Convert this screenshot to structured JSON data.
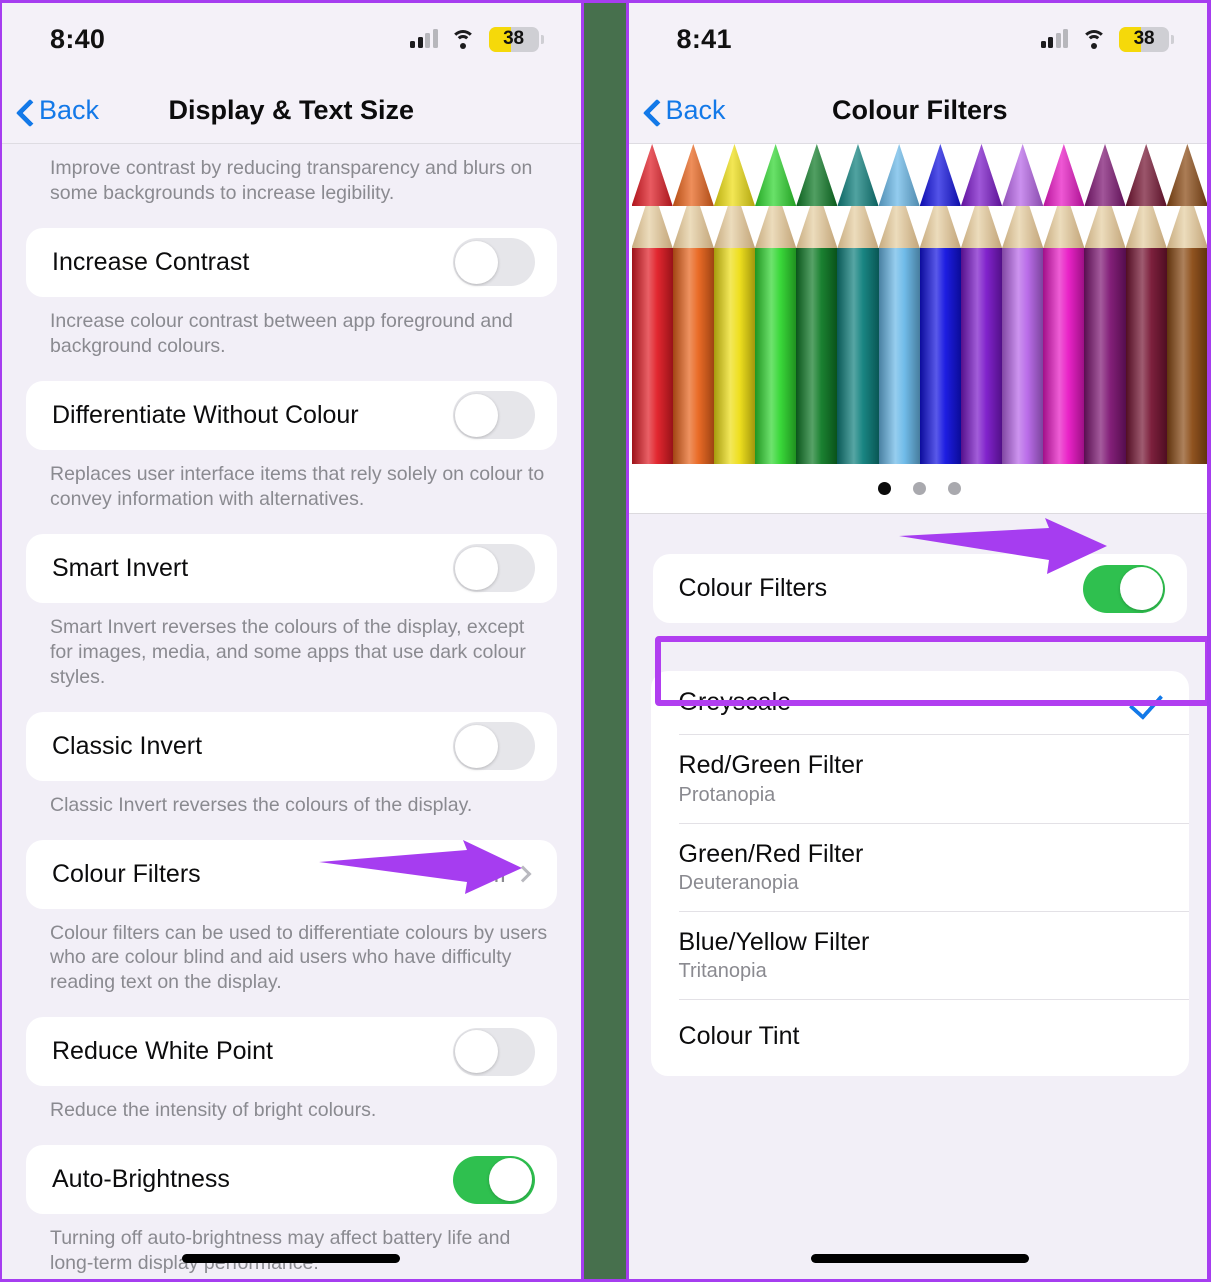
{
  "annotations": {
    "highlight_colour": "#b13ef0",
    "arrow_colour": "#a63df0"
  },
  "left_panel": {
    "status": {
      "time": "8:40",
      "signal_icon": "cellular-bars-icon",
      "wifi_icon": "wifi-icon",
      "battery_level": "38",
      "battery_icon": "battery-icon"
    },
    "nav": {
      "back_label": "Back",
      "back_icon": "chevron-left-icon",
      "title": "Display & Text Size"
    },
    "top_footnote": "Improve contrast by reducing transparency and blurs on some backgrounds to increase legibility.",
    "rows": [
      {
        "label": "Increase Contrast",
        "control": "toggle",
        "state": "off",
        "footnote": "Increase colour contrast between app foreground and background colours."
      },
      {
        "label": "Differentiate Without Colour",
        "control": "toggle",
        "state": "off",
        "footnote": "Replaces user interface items that rely solely on colour to convey information with alternatives."
      },
      {
        "label": "Smart Invert",
        "control": "toggle",
        "state": "off",
        "footnote": "Smart Invert reverses the colours of the display, except for images, media, and some apps that use dark colour styles."
      },
      {
        "label": "Classic Invert",
        "control": "toggle",
        "state": "off",
        "footnote": "Classic Invert reverses the colours of the display."
      },
      {
        "label": "Colour Filters",
        "control": "disclosure",
        "value": "Off",
        "chevron_icon": "chevron-right-icon",
        "footnote": "Colour filters can be used to differentiate colours by users who are colour blind and aid users who have difficulty reading text on the display."
      },
      {
        "label": "Reduce White Point",
        "control": "toggle",
        "state": "off",
        "footnote": "Reduce the intensity of bright colours."
      },
      {
        "label": "Auto-Brightness",
        "control": "toggle",
        "state": "on",
        "footnote": "Turning off auto-brightness may affect battery life and long-term display performance."
      }
    ]
  },
  "right_panel": {
    "status": {
      "time": "8:41",
      "signal_icon": "cellular-bars-icon",
      "wifi_icon": "wifi-icon",
      "battery_level": "38",
      "battery_icon": "battery-icon"
    },
    "nav": {
      "back_label": "Back",
      "back_icon": "chevron-left-icon",
      "title": "Colour Filters"
    },
    "preview": {
      "image_name": "coloured-pencils-preview",
      "pencil_colours": [
        "#e01b24",
        "#e8631b",
        "#eede13",
        "#2fd62f",
        "#0e7a26",
        "#0d7f7c",
        "#69b8e8",
        "#1111e0",
        "#7a17c9",
        "#b765e8",
        "#e817c4",
        "#7d1472",
        "#751432",
        "#8a4a14"
      ],
      "page_dots": 3,
      "active_dot": 1
    },
    "toggle_row": {
      "label": "Colour Filters",
      "state": "on"
    },
    "filters": [
      {
        "title": "Greyscale",
        "subtitle": "",
        "selected": true,
        "check_icon": "check-icon"
      },
      {
        "title": "Red/Green Filter",
        "subtitle": "Protanopia",
        "selected": false
      },
      {
        "title": "Green/Red Filter",
        "subtitle": "Deuteranopia",
        "selected": false
      },
      {
        "title": "Blue/Yellow Filter",
        "subtitle": "Tritanopia",
        "selected": false
      },
      {
        "title": "Colour Tint",
        "subtitle": "",
        "selected": false
      }
    ]
  }
}
